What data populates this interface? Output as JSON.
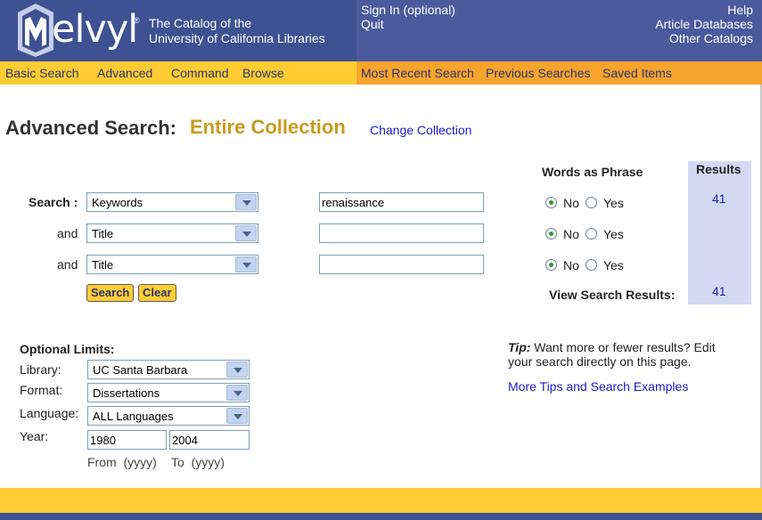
{
  "header": {
    "logo_text": "elvyl",
    "logo_reg": "®",
    "logo_sub1": "The Catalog of the",
    "logo_sub2": "University of California Libraries",
    "left_links": [
      "Sign In (optional)",
      "Quit"
    ],
    "right_links": [
      "Help",
      "Article Databases",
      "Other Catalogs"
    ]
  },
  "nav": {
    "left": [
      "Basic Search",
      "Advanced",
      "Command",
      "Browse"
    ],
    "right": [
      "Most Recent Search",
      "Previous Searches",
      "Saved Items"
    ]
  },
  "page": {
    "title": "Advanced Search:",
    "collection": "Entire Collection",
    "change_collection": "Change Collection"
  },
  "search": {
    "label": "Search :",
    "and_label": "and",
    "rows": [
      {
        "field": "Keywords",
        "value": "renaissance"
      },
      {
        "field": "Title",
        "value": ""
      },
      {
        "field": "Title",
        "value": ""
      }
    ],
    "phrase_header": "Words as Phrase",
    "no_label": "No",
    "yes_label": "Yes",
    "search_button": "Search",
    "clear_button": "Clear",
    "view_results_label": "View Search Results:"
  },
  "results": {
    "header": "Results",
    "row1_count": "41",
    "total_count": "41"
  },
  "limits": {
    "title": "Optional Limits:",
    "library_label": "Library:",
    "library_value": "UC Santa Barbara",
    "format_label": "Format:",
    "format_value": "Dissertations",
    "language_label": "Language:",
    "language_value": "ALL Languages",
    "year_label": "Year:",
    "year_from": "1980",
    "year_to": "2004",
    "from_hint": "From  (yyyy)",
    "to_hint": "To  (yyyy)"
  },
  "tip": {
    "bold": "Tip:",
    "text": " Want more or fewer results? Edit your search directly on this page.",
    "more_link": "More Tips and Search Examples"
  },
  "colors": {
    "header_bg": "#4a5a9c",
    "nav_yellow": "#ffcc33",
    "nav_orange": "#f7a42d",
    "collection_gold": "#c99a1e",
    "link_blue": "#1a1acc",
    "results_bg": "#d4daf4"
  }
}
